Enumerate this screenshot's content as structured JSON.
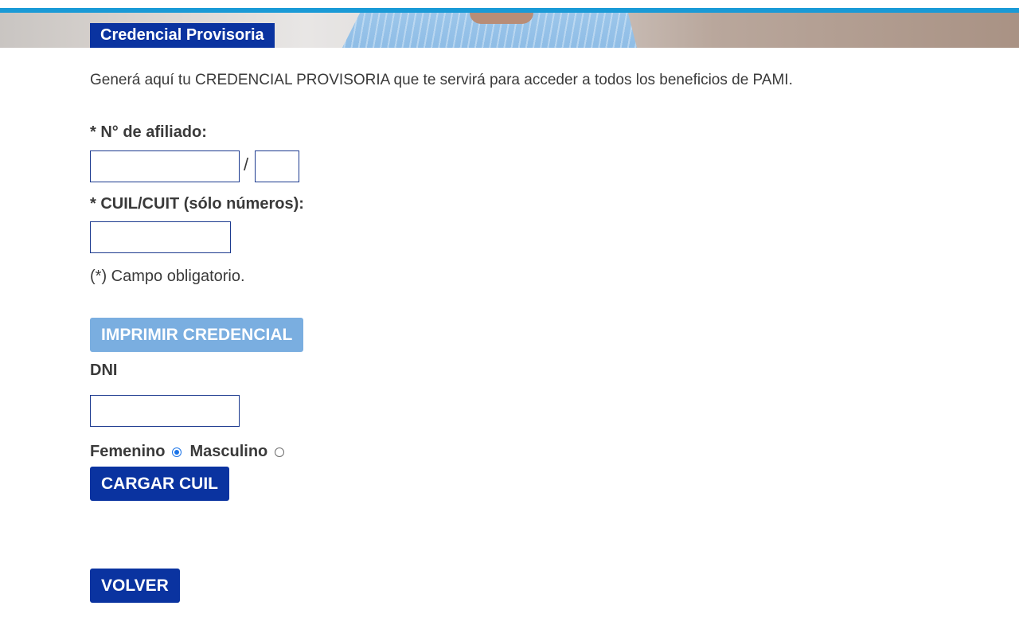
{
  "header": {
    "title": "Credencial Provisoria"
  },
  "intro_text": "Generá aquí tu CREDENCIAL PROVISORIA que te servirá para acceder a todos los beneficios de PAMI.",
  "form": {
    "afiliado_label": "* N° de afiliado:",
    "afiliado_value": "",
    "afiliado_suffix_value": "",
    "separator": "/",
    "cuil_label": "* CUIL/CUIT (sólo números):",
    "cuil_value": "",
    "required_note": "(*) Campo obligatorio.",
    "print_button": "IMPRIMIR CREDENCIAL",
    "dni_label": "DNI",
    "dni_value": "",
    "gender_options": [
      {
        "label": "Femenino",
        "selected": true
      },
      {
        "label": "Masculino",
        "selected": false
      }
    ],
    "load_cuil_button": "CARGAR CUIL",
    "back_button": "VOLVER"
  },
  "colors": {
    "accent_bar": "#1a9ad6",
    "primary": "#0a33a0",
    "disabled_button": "#7aaee0",
    "input_border": "#1c3a8f"
  }
}
